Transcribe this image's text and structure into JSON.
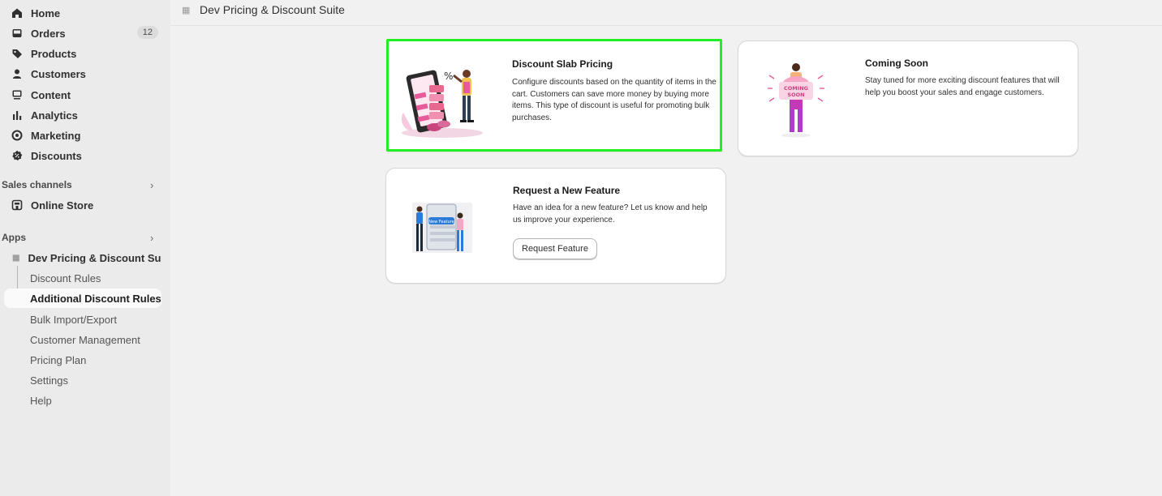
{
  "sidebar": {
    "items": [
      {
        "label": "Home",
        "icon": "home-icon"
      },
      {
        "label": "Orders",
        "icon": "inbox-icon",
        "badge": "12"
      },
      {
        "label": "Products",
        "icon": "tag-icon"
      },
      {
        "label": "Customers",
        "icon": "person-icon"
      },
      {
        "label": "Content",
        "icon": "content-icon"
      },
      {
        "label": "Analytics",
        "icon": "bar-chart-icon"
      },
      {
        "label": "Marketing",
        "icon": "target-icon"
      },
      {
        "label": "Discounts",
        "icon": "discount-icon"
      }
    ],
    "sales_channels": {
      "label": "Sales channels",
      "items": [
        {
          "label": "Online Store",
          "icon": "store-icon"
        }
      ]
    },
    "apps": {
      "label": "Apps",
      "app_name": "Dev Pricing & Discount Su...",
      "sub_items": [
        {
          "label": "Discount Rules"
        },
        {
          "label": "Additional Discount Rules"
        },
        {
          "label": "Bulk Import/Export"
        },
        {
          "label": "Customer Management"
        },
        {
          "label": "Pricing Plan"
        },
        {
          "label": "Settings"
        },
        {
          "label": "Help"
        }
      ]
    }
  },
  "header": {
    "title": "Dev Pricing & Discount Suite"
  },
  "cards": {
    "slab": {
      "title": "Discount Slab Pricing",
      "description": "Configure discounts based on the quantity of items in the cart. Customers can save more money by buying more items. This type of discount is useful for promoting bulk purchases."
    },
    "coming_soon": {
      "title": "Coming Soon",
      "description": "Stay tuned for more exciting discount features that will help you boost your sales and engage customers.",
      "sign_text": "COMING SOON"
    },
    "request": {
      "title": "Request a New Feature",
      "description": "Have an idea for a new feature? Let us know and help us improve your experience.",
      "button": "Request Feature",
      "sign_text": "New Feature"
    }
  },
  "colors": {
    "highlight": "#22ee22",
    "accent_pink": "#e85b9a",
    "accent_blue": "#2b7bd9"
  }
}
